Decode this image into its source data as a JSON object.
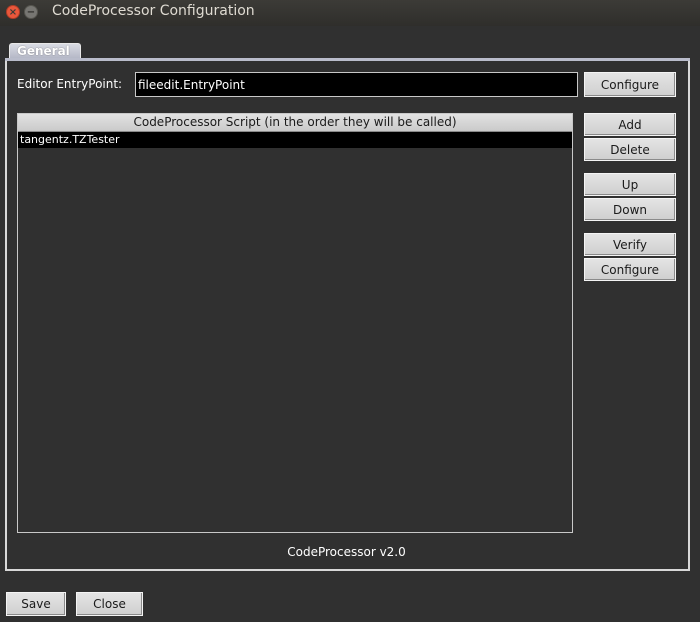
{
  "window": {
    "title": "CodeProcessor Configuration",
    "close_glyph": "×",
    "minimize_glyph": "−"
  },
  "tabs": [
    {
      "label": "General",
      "selected": true
    }
  ],
  "entry_point": {
    "label": "Editor EntryPoint:",
    "value": "fileedit.EntryPoint",
    "configure_label": "Configure"
  },
  "script_list": {
    "header": "CodeProcessor Script (in the order they will be called)",
    "items": [
      {
        "label": "tangentz.TZTester",
        "selected": true
      }
    ]
  },
  "side_buttons": {
    "add": "Add",
    "delete": "Delete",
    "up": "Up",
    "down": "Down",
    "verify": "Verify",
    "configure": "Configure"
  },
  "version": "CodeProcessor v2.0",
  "footer": {
    "save": "Save",
    "close": "Close"
  }
}
